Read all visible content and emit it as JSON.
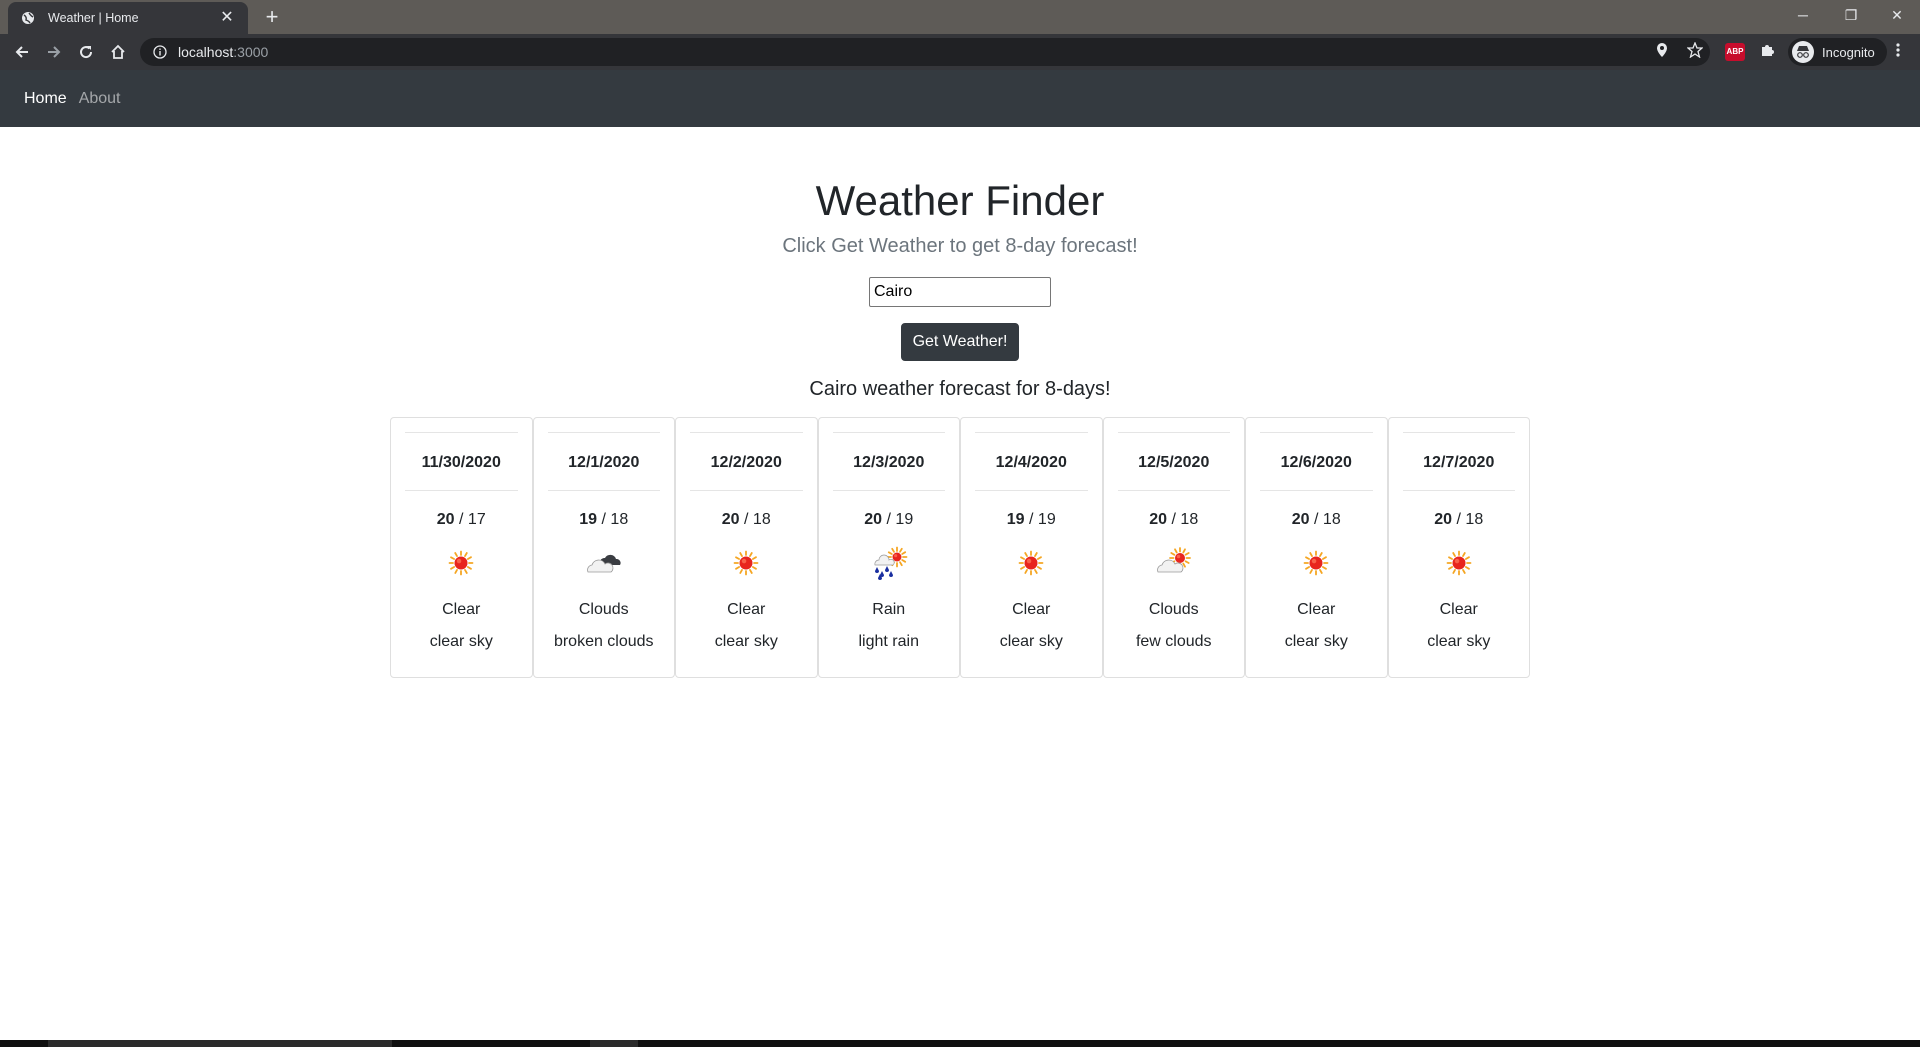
{
  "browser": {
    "tab_title": "Weather | Home",
    "tab_close": "✕",
    "new_tab": "+",
    "url_host": "localhost",
    "url_port": ":3000",
    "abp_label": "ABP",
    "profile_label": "Incognito",
    "controls": {
      "minimize": "─",
      "restore": "❐",
      "close": "✕"
    }
  },
  "navbar": {
    "items": [
      {
        "label": "Home",
        "active": true
      },
      {
        "label": "About",
        "active": false
      }
    ]
  },
  "page": {
    "title": "Weather Finder",
    "subtitle": "Click Get Weather to get 8-day forecast!",
    "city_input_value": "Cairo",
    "button_label": "Get Weather!",
    "forecast_heading": "Cairo weather forecast for 8-days!"
  },
  "forecast": [
    {
      "date": "11/30/2020",
      "high": "20",
      "low": "17",
      "main": "Clear",
      "desc": "clear sky",
      "icon": "sun-icon"
    },
    {
      "date": "12/1/2020",
      "high": "19",
      "low": "18",
      "main": "Clouds",
      "desc": "broken clouds",
      "icon": "broken-clouds-icon"
    },
    {
      "date": "12/2/2020",
      "high": "20",
      "low": "18",
      "main": "Clear",
      "desc": "clear sky",
      "icon": "sun-icon"
    },
    {
      "date": "12/3/2020",
      "high": "20",
      "low": "19",
      "main": "Rain",
      "desc": "light rain",
      "icon": "rain-icon"
    },
    {
      "date": "12/4/2020",
      "high": "19",
      "low": "19",
      "main": "Clear",
      "desc": "clear sky",
      "icon": "sun-icon"
    },
    {
      "date": "12/5/2020",
      "high": "20",
      "low": "18",
      "main": "Clouds",
      "desc": "few clouds",
      "icon": "few-clouds-icon"
    },
    {
      "date": "12/6/2020",
      "high": "20",
      "low": "18",
      "main": "Clear",
      "desc": "clear sky",
      "icon": "sun-icon"
    },
    {
      "date": "12/7/2020",
      "high": "20",
      "low": "18",
      "main": "Clear",
      "desc": "clear sky",
      "icon": "sun-icon"
    }
  ],
  "colors": {
    "navbar_bg": "#343a40",
    "button_bg": "#343a40",
    "sun": "#e8251e",
    "sun_rays": "#f5a623",
    "rain": "#1a2fa0"
  }
}
